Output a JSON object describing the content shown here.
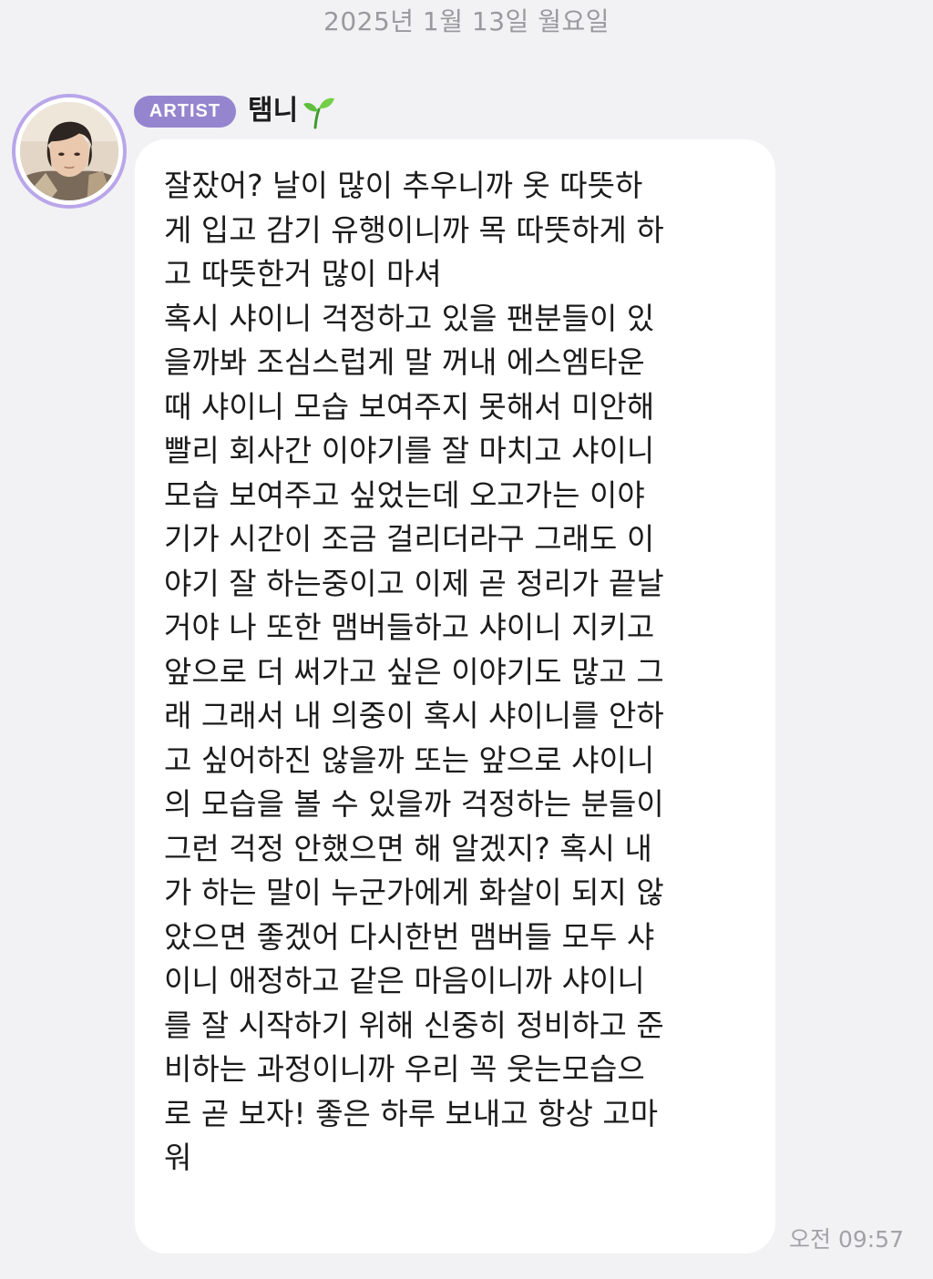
{
  "date_separator": "2025년 1월 13일 월요일",
  "sender": {
    "badge": "ARTIST",
    "name": "탬니",
    "name_emoji_icon": "seedling-icon",
    "avatar_icon": "profile-photo"
  },
  "message": {
    "lines": [
      "잘잤어? 날이 많이 추우니까 옷 따뜻하",
      "게 입고 감기 유행이니까 목 따뜻하게 하",
      "고 따뜻한거 많이 마셔",
      "혹시 샤이니 걱정하고 있을 팬분들이 있",
      "을까봐 조심스럽게 말 꺼내 에스엠타운",
      "때 샤이니 모습 보여주지 못해서 미안해",
      "빨리 회사간 이야기를 잘 마치고 샤이니",
      "모습 보여주고 싶었는데 오고가는 이야",
      "기가 시간이 조금 걸리더라구 그래도 이",
      "야기 잘 하는중이고 이제 곧 정리가 끝날",
      "거야 나 또한 맴버들하고 샤이니 지키고",
      "앞으로 더 써가고 싶은 이야기도 많고 그",
      "래 그래서 내 의중이 혹시 샤이니를 안하",
      "고 싶어하진 않을까 또는 앞으로 샤이니",
      "의 모습을 볼 수 있을까 걱정하는 분들이",
      "그런 걱정 안했으면 해 알겠지? 혹시 내",
      "가 하는 말이 누군가에게 화살이 되지 않",
      "았으면 좋겠어 다시한번 맴버들 모두 샤",
      "이니 애정하고 같은 마음이니까 샤이니",
      "를 잘 시작하기 위해 신중히 정비하고 준",
      "비하는 과정이니까 우리 꼭 웃는모습으",
      "로 곧 보자! 좋은 하루 보내고 항상 고마",
      "워"
    ],
    "timestamp": "오전 09:57"
  },
  "colors": {
    "background": "#f2f2f4",
    "bubble": "#ffffff",
    "badge": "#9585cf",
    "avatar_ring": "#b9a6ea",
    "meta_text": "#9a9a9e"
  }
}
